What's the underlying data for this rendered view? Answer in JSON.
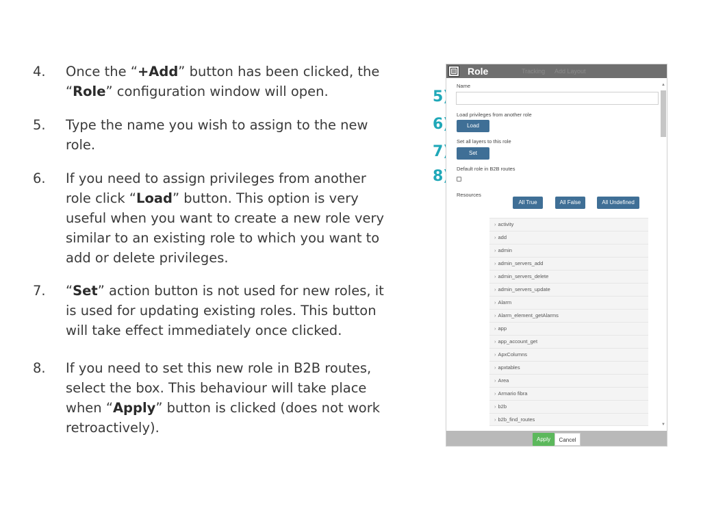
{
  "steps": [
    {
      "num": "4.",
      "parts": [
        "Once the “",
        "+Add",
        "” button has been clicked, the “",
        "Role",
        "” configuration window will open."
      ]
    },
    {
      "num": "5.",
      "parts": [
        "Type the name you wish to assign to the new role."
      ]
    },
    {
      "num": "6.",
      "parts": [
        "If you need to assign privileges from another role click “",
        "Load",
        "” button. This option is very useful when you want to create a new role very similar to an existing role to which you want to add or delete privileges."
      ]
    },
    {
      "num": "7.",
      "parts": [
        "“",
        "Set",
        "” action button is not used for new roles, it is used for updating existing roles. This button will take effect immediately once clicked."
      ]
    },
    {
      "num": "8.",
      "parts": [
        "If you need to set this new role in B2B routes, select the box. This behaviour will take place when “",
        "Apply",
        "” button is clicked (does not work retroactively)."
      ]
    }
  ],
  "callouts": [
    "5)",
    "6)",
    "7)",
    "8)"
  ],
  "dialog": {
    "title": "Role",
    "faded_header": [
      "Tracking",
      "Add Layout"
    ],
    "name_label": "Name",
    "name_value": "",
    "load_label": "Load privileges from another role",
    "load_button": "Load",
    "set_label": "Set all layers to this role",
    "set_button": "Set",
    "b2b_label": "Default role in B2B routes",
    "b2b_checked": false,
    "resources_label": "Resources",
    "all_true": "All True",
    "all_false": "All False",
    "all_undefined": "All Undefined",
    "resources": [
      "activity",
      "add",
      "admin",
      "admin_servers_add",
      "admin_servers_delete",
      "admin_servers_update",
      "Alarm",
      "Alarm_element_getAlarms",
      "app",
      "app_account_get",
      "ApxColumns",
      "apxtables",
      "Area",
      "Armario fibra",
      "b2b",
      "b2b_find_routes"
    ],
    "apply": "Apply",
    "cancel": "Cancel"
  },
  "colors": {
    "callout": "#20a8b8",
    "button_blue": "#3f6f96",
    "apply_green": "#5cb85c",
    "header_gray": "#6f6f6f"
  },
  "icons": {
    "header": "list-window-icon",
    "resource_row": "chevron-right-icon",
    "scroll_up": "caret-up-icon",
    "scroll_down": "caret-down-icon"
  }
}
